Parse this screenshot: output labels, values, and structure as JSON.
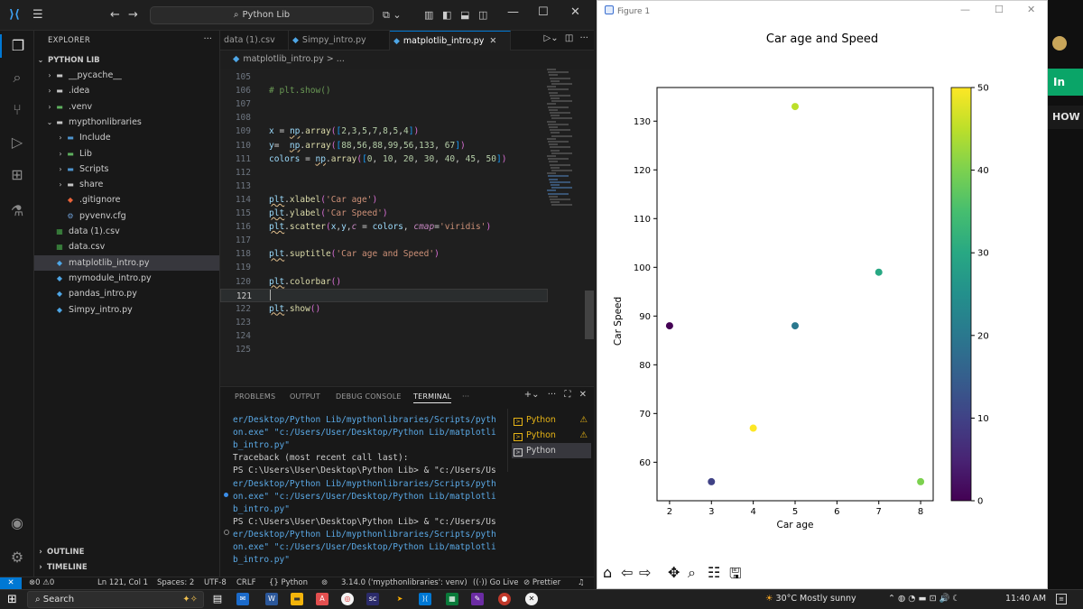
{
  "vscode": {
    "search": "Python Lib",
    "explorer_title": "EXPLORER",
    "root_folder": "PYTHON LIB",
    "tree": [
      {
        "label": "__pycache__",
        "indent": 1,
        "chev": "›",
        "icon": "folder"
      },
      {
        "label": ".idea",
        "indent": 1,
        "chev": "›",
        "icon": "folder"
      },
      {
        "label": ".venv",
        "indent": 1,
        "chev": "›",
        "icon": "folder-green"
      },
      {
        "label": "mypthonlibraries",
        "indent": 1,
        "chev": "⌄",
        "icon": "folder"
      },
      {
        "label": "Include",
        "indent": 2,
        "chev": "›",
        "icon": "folder-blue"
      },
      {
        "label": "Lib",
        "indent": 2,
        "chev": "›",
        "icon": "folder-green"
      },
      {
        "label": "Scripts",
        "indent": 2,
        "chev": "›",
        "icon": "folder-blue"
      },
      {
        "label": "share",
        "indent": 2,
        "chev": "›",
        "icon": "folder"
      },
      {
        "label": ".gitignore",
        "indent": 2,
        "chev": "",
        "icon": "git"
      },
      {
        "label": "pyvenv.cfg",
        "indent": 2,
        "chev": "",
        "icon": "gear"
      },
      {
        "label": "data (1).csv",
        "indent": 1,
        "chev": "",
        "icon": "csv"
      },
      {
        "label": "data.csv",
        "indent": 1,
        "chev": "",
        "icon": "csv"
      },
      {
        "label": "matplotlib_intro.py",
        "indent": 1,
        "chev": "",
        "icon": "python",
        "selected": true
      },
      {
        "label": "mymodule_intro.py",
        "indent": 1,
        "chev": "",
        "icon": "python"
      },
      {
        "label": "pandas_intro.py",
        "indent": 1,
        "chev": "",
        "icon": "python"
      },
      {
        "label": "Simpy_intro.py",
        "indent": 1,
        "chev": "",
        "icon": "python"
      }
    ],
    "outline_label": "OUTLINE",
    "timeline_label": "TIMELINE",
    "tabs": [
      {
        "label": "data (1).csv",
        "icon": "csv",
        "active": false
      },
      {
        "label": "Simpy_intro.py",
        "icon": "python",
        "active": false
      },
      {
        "label": "matplotlib_intro.py",
        "icon": "python",
        "active": true
      }
    ],
    "breadcrumb": "matplotlib_intro.py > ...",
    "code_lines": [
      {
        "n": "105",
        "html": ""
      },
      {
        "n": "106",
        "html": "<span class='tk-cm'># plt.show()</span>"
      },
      {
        "n": "107",
        "html": ""
      },
      {
        "n": "108",
        "html": ""
      },
      {
        "n": "109",
        "html": "<span class='tk-var'>x</span> <span class='tk-op'>=</span> <span class='squig'><span class='tk-var'>np</span></span><span class='tk-op'>.</span><span class='tk-fn'>array</span><span class='tk-par'>(</span><span class='tk-brk'>[</span><span class='tk-num'>2</span>,<span class='tk-num'>3</span>,<span class='tk-num'>5</span>,<span class='tk-num'>7</span>,<span class='tk-num'>8</span>,<span class='tk-num'>5</span>,<span class='tk-num'>4</span><span class='tk-brk'>]</span><span class='tk-par'>)</span>"
      },
      {
        "n": "110",
        "html": "<span class='tk-var'>y</span><span class='tk-op'>=</span>  <span class='squig'><span class='tk-var'>np</span></span><span class='tk-op'>.</span><span class='tk-fn'>array</span><span class='tk-par'>(</span><span class='tk-brk'>[</span><span class='tk-num'>88</span>,<span class='tk-num'>56</span>,<span class='tk-num'>88</span>,<span class='tk-num'>99</span>,<span class='tk-num'>56</span>,<span class='tk-num'>133</span>, <span class='tk-num'>67</span><span class='tk-brk'>]</span><span class='tk-par'>)</span>"
      },
      {
        "n": "111",
        "html": "<span class='tk-var'>colors</span> <span class='tk-op'>=</span> <span class='squig'><span class='tk-var'>np</span></span><span class='tk-op'>.</span><span class='tk-fn'>array</span><span class='tk-par'>(</span><span class='tk-brk'>[</span><span class='tk-num'>0</span>, <span class='tk-num'>10</span>, <span class='tk-num'>20</span>, <span class='tk-num'>30</span>, <span class='tk-num'>40</span>, <span class='tk-num'>45</span>, <span class='tk-num'>50</span><span class='tk-brk'>]</span><span class='tk-par'>)</span>"
      },
      {
        "n": "112",
        "html": ""
      },
      {
        "n": "113",
        "html": ""
      },
      {
        "n": "114",
        "html": "<span class='squig'><span class='tk-var'>plt</span></span><span class='tk-op'>.</span><span class='tk-fn'>xlabel</span><span class='tk-par'>(</span><span class='tk-str'>'Car age'</span><span class='tk-par'>)</span>"
      },
      {
        "n": "115",
        "html": "<span class='squig'><span class='tk-var'>plt</span></span><span class='tk-op'>.</span><span class='tk-fn'>ylabel</span><span class='tk-par'>(</span><span class='tk-str'>'Car Speed'</span><span class='tk-par'>)</span>"
      },
      {
        "n": "116",
        "html": "<span class='squig'><span class='tk-var'>plt</span></span><span class='tk-op'>.</span><span class='tk-fn'>scatter</span><span class='tk-par'>(</span><span class='tk-var'>x</span>,<span class='tk-var'>y</span>,<span class='tk-kw'>c</span> <span class='tk-op'>=</span> <span class='tk-var'>colors</span>, <span class='tk-kw'>cmap</span><span class='tk-op'>=</span><span class='tk-str'>'viridis'</span><span class='tk-par'>)</span>"
      },
      {
        "n": "117",
        "html": ""
      },
      {
        "n": "118",
        "html": "<span class='squig'><span class='tk-var'>plt</span></span><span class='tk-op'>.</span><span class='tk-fn'>suptitle</span><span class='tk-par'>(</span><span class='tk-str'>'Car age and Speed'</span><span class='tk-par'>)</span>"
      },
      {
        "n": "119",
        "html": ""
      },
      {
        "n": "120",
        "html": "<span class='squig'><span class='tk-var'>plt</span></span><span class='tk-op'>.</span><span class='tk-fn'>colorbar</span><span class='tk-par'>()</span>"
      },
      {
        "n": "121",
        "html": "",
        "current": true
      },
      {
        "n": "122",
        "html": "<span class='squig'><span class='tk-var'>plt</span></span><span class='tk-op'>.</span><span class='tk-fn'>show</span><span class='tk-par'>()</span>"
      },
      {
        "n": "123",
        "html": ""
      },
      {
        "n": "124",
        "html": ""
      },
      {
        "n": "125",
        "html": ""
      }
    ],
    "panel_tabs": [
      "PROBLEMS",
      "OUTPUT",
      "DEBUG CONSOLE",
      "TERMINAL"
    ],
    "active_panel_tab": "TERMINAL",
    "terminal_lines": [
      "er/Desktop/Python Lib/mypthonlibraries/Scripts/pyth",
      "on.exe\" \"c:/Users/User/Desktop/Python Lib/matplotli",
      "b_intro.py\"",
      "Traceback (most recent call last):",
      "PS C:\\Users\\User\\Desktop\\Python Lib> & \"c:/Users/Us",
      "er/Desktop/Python Lib/mypthonlibraries/Scripts/pyth",
      "on.exe\" \"c:/Users/User/Desktop/Python Lib/matplotli",
      "b_intro.py\"",
      "PS C:\\Users\\User\\Desktop\\Python Lib> & \"c:/Users/Us",
      "er/Desktop/Python Lib/mypthonlibraries/Scripts/pyth",
      "on.exe\" \"c:/Users/User/Desktop/Python Lib/matplotli",
      "b_intro.py\""
    ],
    "terminal_sessions": [
      {
        "label": "Python",
        "warn": true,
        "selected": false
      },
      {
        "label": "Python",
        "warn": true,
        "selected": false
      },
      {
        "label": "Python",
        "warn": false,
        "selected": true
      }
    ],
    "status": {
      "errors": "0",
      "warnings": "0",
      "position": "Ln 121, Col 1",
      "spaces": "Spaces: 2",
      "encoding": "UTF-8",
      "eol": "CRLF",
      "language": "{} Python",
      "interpreter": "3.14.0 ('mypthonlibraries': venv)",
      "golive": "Go Live",
      "prettier": "Prettier"
    }
  },
  "figure": {
    "window_title": "Figure 1"
  },
  "chart_data": {
    "type": "scatter",
    "title": "Car age and Speed",
    "xlabel": "Car age",
    "ylabel": "Car Speed",
    "x": [
      2,
      3,
      5,
      7,
      8,
      5,
      4
    ],
    "y": [
      88,
      56,
      88,
      99,
      56,
      133,
      67
    ],
    "c": [
      0,
      10,
      20,
      30,
      40,
      45,
      50
    ],
    "cmap": "viridis",
    "xlim": [
      1.7,
      8.3
    ],
    "ylim": [
      52.1,
      136.9
    ],
    "xticks": [
      2,
      3,
      4,
      5,
      6,
      7,
      8
    ],
    "yticks": [
      60,
      70,
      80,
      90,
      100,
      110,
      120,
      130
    ],
    "colorbar": {
      "range": [
        0,
        50
      ],
      "ticks": [
        0,
        10,
        20,
        30,
        40,
        50
      ]
    },
    "grid": false
  },
  "background": {
    "in_label": "In",
    "how_label": "HOW"
  },
  "taskbar": {
    "search_placeholder": "Search",
    "weather": "30°C  Mostly sunny",
    "time": "11:40 AM"
  }
}
